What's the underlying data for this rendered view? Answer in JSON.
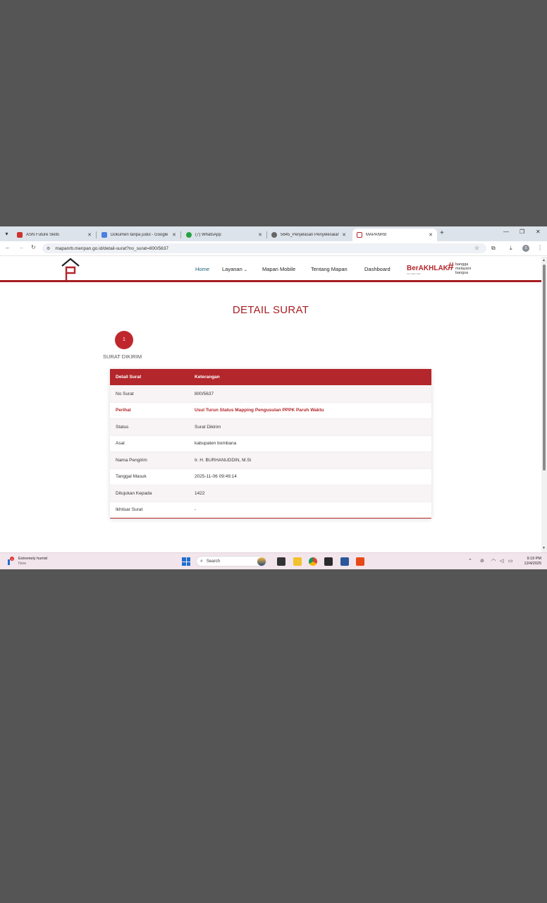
{
  "browser": {
    "tabs": [
      {
        "title": "ASN Future Skills",
        "icon": "asn-favicon",
        "active": false
      },
      {
        "title": "Dokumen tanpa judul - Google",
        "icon": "google-docs-favicon",
        "active": false
      },
      {
        "title": "(7) WhatsApp",
        "icon": "whatsapp-favicon",
        "active": false
      },
      {
        "title": "5645_Penjelasan Penyelesaian",
        "icon": "globe-favicon",
        "active": false
      },
      {
        "title": "MAPANRB",
        "icon": "mapan-favicon",
        "active": true
      }
    ],
    "new_tab": "+",
    "url": "mapanrb.menpan.go.id/detail-surat?no_surat=800/5637"
  },
  "site": {
    "nav": {
      "home": "Home",
      "layanan": "Layanan",
      "mobile": "Mapan Mobile",
      "tentang": "Tentang Mapan",
      "dashboard": "Dashboard"
    },
    "brand": {
      "word": "BerAKHLAK",
      "tagline": "Core Values ASN",
      "slogan_1": "bangga",
      "slogan_2": "melayani",
      "slogan_3": "bangsa"
    }
  },
  "page": {
    "title": "DETAIL SURAT",
    "step_number": "1",
    "step_label": "SURAT DIKIRIM",
    "table": {
      "headers": [
        "Detail Surat",
        "Keterangan"
      ],
      "rows": [
        {
          "label": "No Surat",
          "value": "800/5637"
        },
        {
          "label": "Perihal",
          "value": "Usul Turun Status Mapping Pengusulan PPPK Paruh Waktu"
        },
        {
          "label": "Status",
          "value": "Surat Dikirim"
        },
        {
          "label": "Asal",
          "value": "kabupaten bombana"
        },
        {
          "label": "Nama Pengirim",
          "value": "Ir. H. BURHANUDDIN, M.Si"
        },
        {
          "label": "Tanggal Masuk",
          "value": "2025-11-06 09:49:14"
        },
        {
          "label": "Ditujukan Kepada",
          "value": "1422"
        },
        {
          "label": "Ikhtisar Surat",
          "value": "-"
        }
      ]
    }
  },
  "taskbar": {
    "weather_title": "Extremely humid",
    "weather_sub": "Now",
    "search_placeholder": "Search",
    "time": "9:19 PM",
    "date": "12/4/2025"
  },
  "colors": {
    "brand_red": "#b3262b",
    "nav_active": "#1a5f7a"
  }
}
